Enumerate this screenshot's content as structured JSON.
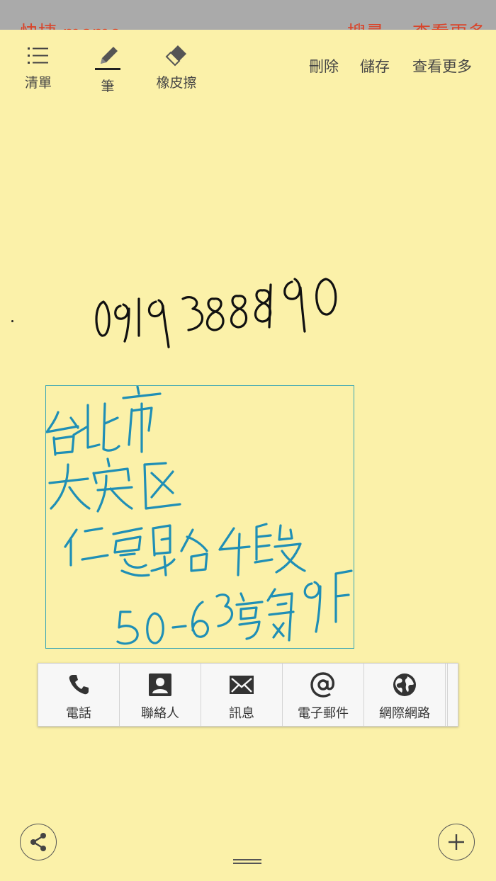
{
  "background_app": {
    "title": "快捷 memo",
    "search": "搜尋",
    "more": "查看更多"
  },
  "toolbar": {
    "list_label": "清單",
    "pen_label": "筆",
    "eraser_label": "橡皮擦",
    "delete_label": "刪除",
    "save_label": "儲存",
    "more_label": "查看更多"
  },
  "handwriting": {
    "phone_number": "0919388190",
    "address_lines": [
      "台北市",
      "大安区",
      "仁愛路4段",
      "50-63號9F"
    ],
    "ink_colors": {
      "phone": "#111111",
      "address": "#1f8fb6"
    }
  },
  "detected_actions": [
    {
      "label": "電話",
      "icon": "phone-icon"
    },
    {
      "label": "聯絡人",
      "icon": "contact-icon"
    },
    {
      "label": "訊息",
      "icon": "message-icon"
    },
    {
      "label": "電子郵件",
      "icon": "at-icon"
    },
    {
      "label": "網際網路",
      "icon": "globe-icon"
    }
  ],
  "colors": {
    "memo_background": "#fbf1a9",
    "selection_border": "#3aa6b4",
    "background_app_accent": "#d9442a"
  }
}
